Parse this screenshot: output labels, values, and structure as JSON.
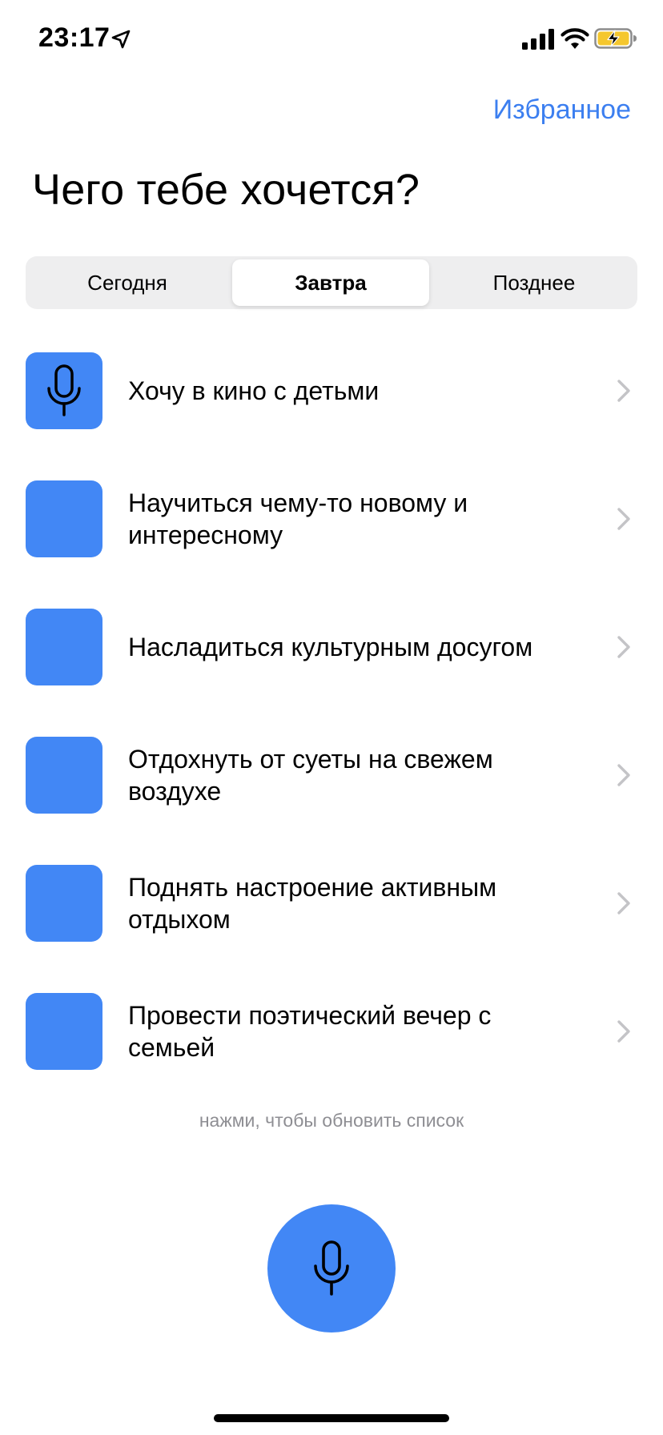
{
  "status_bar": {
    "time": "23:17",
    "icons": [
      "location-arrow-icon",
      "cellular-signal-icon",
      "wifi-icon",
      "battery-charging-icon"
    ]
  },
  "header": {
    "favorites_label": "Избранное",
    "title": "Чего тебе хочется?"
  },
  "segments": {
    "items": [
      "Сегодня",
      "Завтра",
      "Позднее"
    ],
    "selected": "Завтра"
  },
  "suggestions": [
    {
      "label": "Хочу в кино с детьми",
      "icon": "microphone-icon"
    },
    {
      "label": "Научиться чему-то новому и интересному",
      "icon": ""
    },
    {
      "label": "Насладиться культурным досугом",
      "icon": ""
    },
    {
      "label": "Отдохнуть от суеты на свежем воздухе",
      "icon": ""
    },
    {
      "label": "Поднять настроение активным отдыхом",
      "icon": ""
    },
    {
      "label": "Провести поэтический вечер с семьей",
      "icon": ""
    }
  ],
  "refresh_hint": "нажми, чтобы обновить список",
  "colors": {
    "accent": "#4287f5",
    "link": "#3c7ff0",
    "hint": "#8e8e93",
    "segment_bg": "#eeeeef",
    "battery_fill": "#f5c72e"
  }
}
